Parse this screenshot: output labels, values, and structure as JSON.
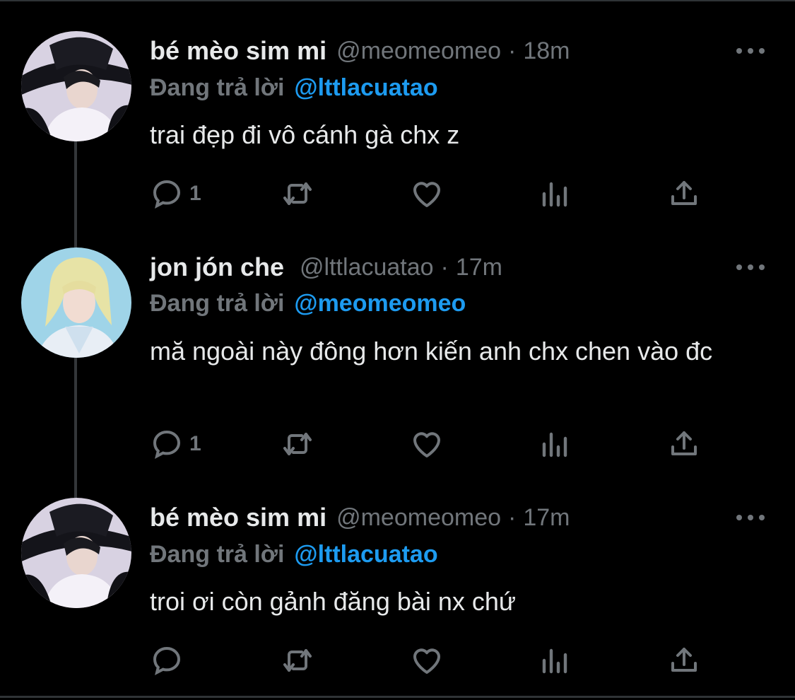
{
  "tweets": [
    {
      "display_name": "bé mèo sim mi",
      "handle": "@meomeomeo",
      "time": "18m",
      "reply_label": "Đang trả lời",
      "reply_handle": "@lttlacuatao",
      "text": "trai đẹp đi vô cánh gà chx z",
      "reply_count": "1",
      "avatar": "dark-hat-avatar"
    },
    {
      "display_name": "jon jón che",
      "handle": "@lttlacuatao",
      "time": "17m",
      "reply_label": "Đang trả lời",
      "reply_handle": "@meomeomeo",
      "text": "mă ngoài này đông hơn kiến anh chx chen vào đc",
      "reply_count": "1",
      "avatar": "blonde-avatar"
    },
    {
      "display_name": "bé mèo sim mi",
      "handle": "@meomeomeo",
      "time": "17m",
      "reply_label": "Đang trả lời",
      "reply_handle": "@lttlacuatao",
      "text": "troi ơi còn gảnh đăng bài nx chứ",
      "reply_count": "",
      "avatar": "dark-hat-avatar"
    }
  ],
  "separator": "·",
  "icons": [
    "reply-icon",
    "retweet-icon",
    "like-icon",
    "views-icon",
    "share-icon",
    "more-icon"
  ],
  "colors": {
    "background": "#000000",
    "text": "#e7e9ea",
    "muted": "#71767b",
    "link": "#1d9bf0"
  }
}
